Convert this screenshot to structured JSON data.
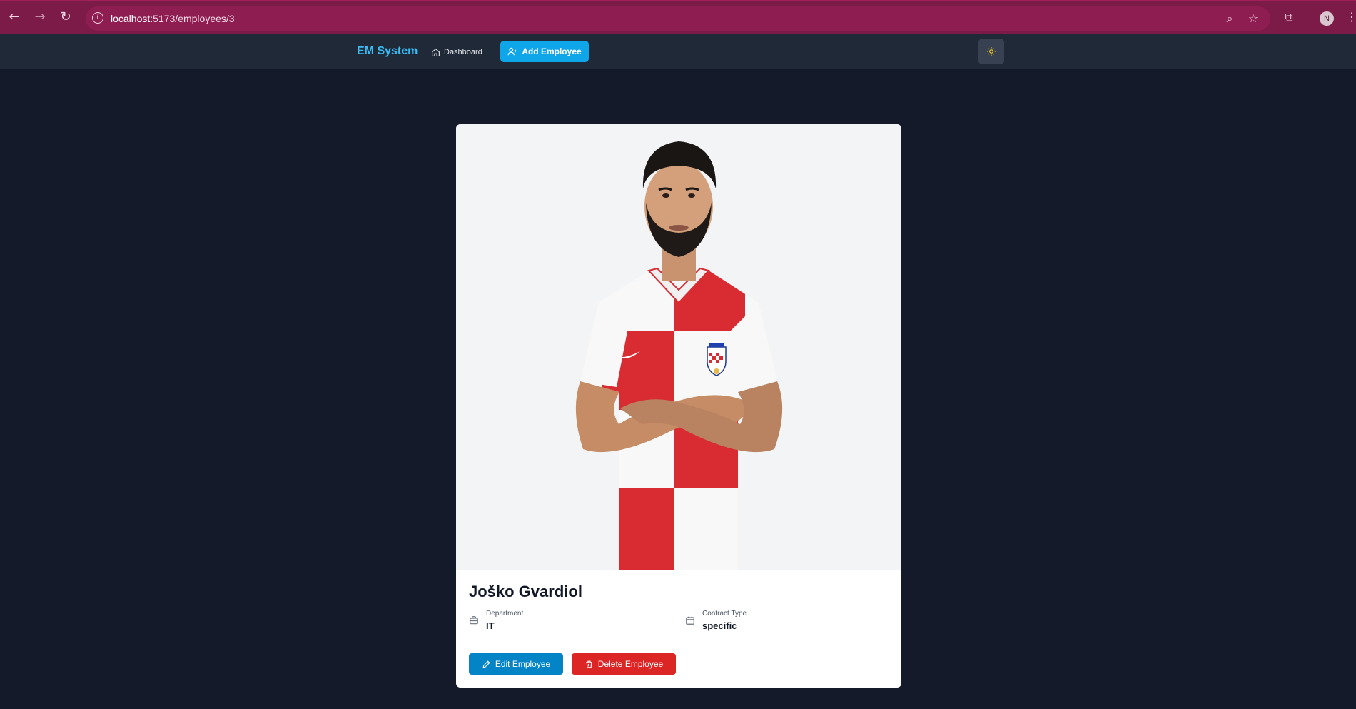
{
  "browser": {
    "url_host": "localhost",
    "url_path": ":5173/employees/3",
    "profile_initial": "N"
  },
  "navbar": {
    "brand": "EM System",
    "dashboard_label": "Dashboard",
    "add_employee_label": "Add Employee"
  },
  "employee": {
    "name": "Joško Gvardiol",
    "department_label": "Department",
    "department": "IT",
    "contract_label": "Contract Type",
    "contract_type": "specific",
    "edit_label": "Edit Employee",
    "delete_label": "Delete Employee"
  },
  "colors": {
    "accent": "#0ea5e9",
    "brand": "#38bdf8",
    "danger": "#dc2626",
    "page_bg": "#141a2a",
    "navbar_bg": "#1f2937"
  }
}
